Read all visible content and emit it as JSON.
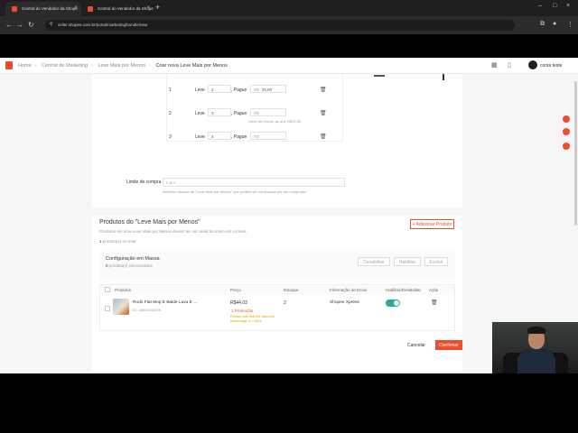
{
  "browser": {
    "tabs": [
      {
        "title": "Central do Vendedor da Shope"
      },
      {
        "title": "Central do Vendedor da Shope"
      }
    ],
    "url": "seller.shopee.com.br/portal/marketing/bundle/new"
  },
  "header": {
    "breadcrumb": [
      "Home",
      "Central de Marketing",
      "Leve Mais por Menos",
      "Criar nova Leve Mais por Menos"
    ],
    "username": "conta teste"
  },
  "tiers": {
    "rows": [
      {
        "num": "1",
        "leve_label": "Leve",
        "leve_value": "2",
        "pague_label": ", Pague",
        "currency": "R$",
        "price": "29,00",
        "note": ""
      },
      {
        "num": "2",
        "leve_label": "Leve",
        "leve_value": "3",
        "pague_label": ", Pague",
        "currency": "R$",
        "price": "",
        "note": "Deve ser menor do que R$29,00"
      },
      {
        "num": "3",
        "leve_label": "Leve",
        "leve_value": "4",
        "pague_label": ", Pague",
        "currency": "R$",
        "price": "",
        "note": ""
      }
    ]
  },
  "purchase_limit": {
    "label": "Limite de compra",
    "placeholder": "Input",
    "hint": "Número máximo de \"Leve Mais por Menos\" que podem ser comprados por um comprador"
  },
  "products_section": {
    "title": "Produtos do \"Leve Mais por Menos\"",
    "description": "Produtos em uma Leve Mais por Menos devem ter um canal de envio em comum.",
    "add_button": "+ Adicionar Produto",
    "count_num": "1",
    "count_text": "produto(s) no total"
  },
  "bulk": {
    "title": "Configuração em Massa",
    "count_num": "0",
    "count_text": "produto(s) selecionados",
    "buttons": [
      "Desabilitar",
      "Habilitar",
      "Excluir"
    ]
  },
  "table": {
    "headers": [
      "Produtos",
      "Preço",
      "Estoque",
      "Informação de Envio",
      "Habilitar/Desabilitar",
      "Ação"
    ],
    "rows": [
      {
        "name": "Rodo Flat Mop E Balde Lava E ...",
        "id": "ID: 18444044478",
        "price": "R$44,03",
        "promo": "1 Promoção",
        "warning": "Please note that the discount percentage is < 50%",
        "stock": "2",
        "shipping": "Shopee Xpress",
        "enabled": true
      }
    ]
  },
  "footer": {
    "cancel": "Cancelar",
    "confirm": "Confirmar"
  },
  "colors": {
    "brand": "#ee4d2d",
    "toggle_on": "#26aa99"
  }
}
